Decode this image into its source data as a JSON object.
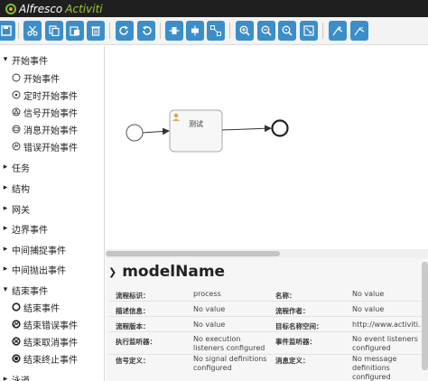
{
  "header": {
    "brand_alfresco": "Alfresco",
    "brand_activiti": "Activiti"
  },
  "toolbar": {
    "buttons": [
      "save-icon",
      "cut-icon",
      "copy-icon",
      "paste-icon",
      "delete-icon",
      "redo-icon",
      "undo-icon",
      "align-horizontal-icon",
      "align-vertical-icon",
      "connect-icon",
      "zoom-in-icon",
      "zoom-out-icon",
      "zoom-actual-icon",
      "zoom-fit-icon",
      "bendpoint-add-icon",
      "bendpoint-remove-icon"
    ],
    "accent": "#3b8ec9"
  },
  "palette": {
    "start_group": "开始事件",
    "start_items": [
      "开始事件",
      "定时开始事件",
      "信号开始事件",
      "消息开始事件",
      "错误开始事件"
    ],
    "groups_middle": [
      "任务",
      "结构",
      "网关",
      "边界事件",
      "中间捕捉事件",
      "中间抛出事件"
    ],
    "end_group": "结束事件",
    "end_items": [
      "结束事件",
      "结束错误事件",
      "结束取消事件",
      "结束终止事件"
    ],
    "last_group": "泳道"
  },
  "canvas": {
    "task_label": "测试"
  },
  "properties": {
    "title": "modelName",
    "rows": [
      {
        "label1": "流程标识：",
        "value1": "process",
        "label2": "名称：",
        "value2": "No value"
      },
      {
        "label1": "描述信息：",
        "value1": "No value",
        "label2": "流程作者：",
        "value2": "No value"
      },
      {
        "label1": "流程版本：",
        "value1": "No value",
        "label2": "目标名称空间：",
        "value2": "http://www.activiti."
      },
      {
        "label1": "执行监听器：",
        "value1": "No execution listeners configured",
        "label2": "事件监听器：",
        "value2": "No event listeners configured"
      },
      {
        "label1": "信号定义：",
        "value1": "No signal definitions configured",
        "label2": "消息定义：",
        "value2": "No message definitions configured"
      }
    ]
  }
}
